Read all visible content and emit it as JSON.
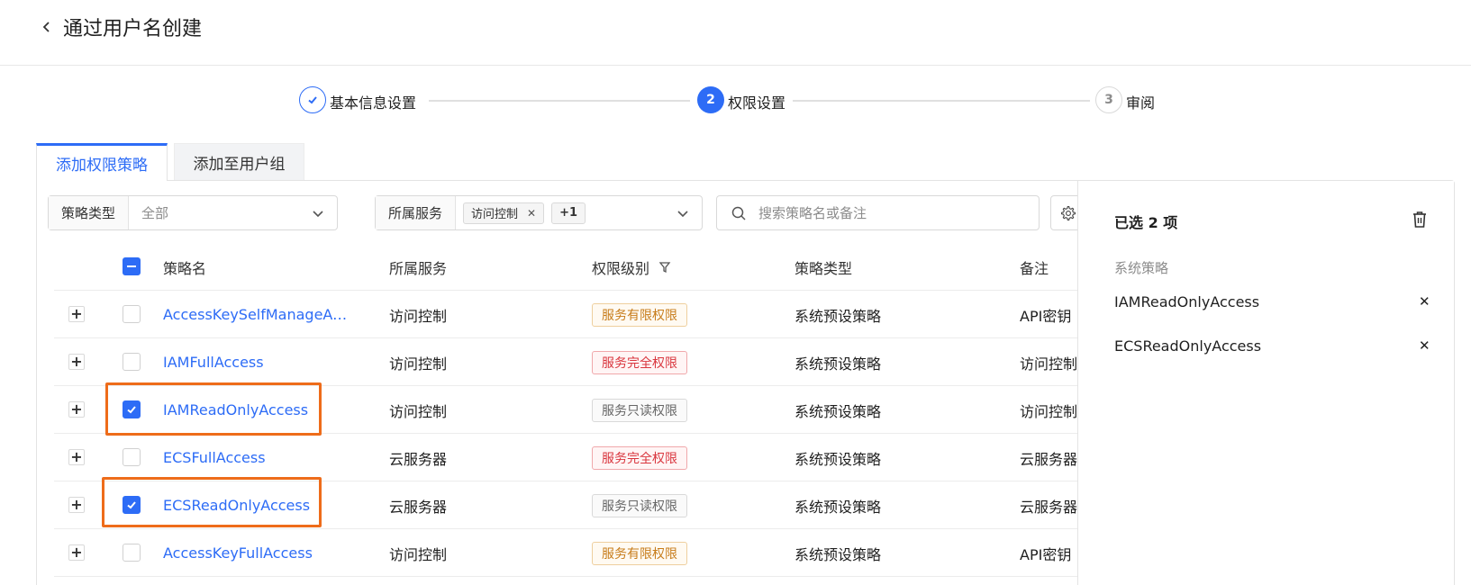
{
  "header": {
    "title": "通过用户名创建"
  },
  "steps": [
    {
      "number": "1",
      "label": "基本信息设置",
      "status": "done"
    },
    {
      "number": "2",
      "label": "权限设置",
      "status": "active"
    },
    {
      "number": "3",
      "label": "审阅",
      "status": "todo"
    }
  ],
  "tabs": [
    {
      "label": "添加权限策略",
      "active": true
    },
    {
      "label": "添加至用户组",
      "active": false
    }
  ],
  "filters": {
    "policy_type": {
      "label": "策略类型",
      "value": "全部"
    },
    "service": {
      "label": "所属服务",
      "tags": [
        "访问控制"
      ],
      "more": "+1"
    },
    "search": {
      "placeholder": "搜索策略名或备注",
      "value": ""
    }
  },
  "table": {
    "columns": [
      "策略名",
      "所属服务",
      "权限级别",
      "策略类型",
      "备注"
    ],
    "rows": [
      {
        "name": "AccessKeySelfManageAcc...",
        "service": "访问控制",
        "level": "服务有限权限",
        "level_kind": "limited",
        "type": "系统预设策略",
        "note": "API密钥",
        "checked": false
      },
      {
        "name": "IAMFullAccess",
        "service": "访问控制",
        "level": "服务完全权限",
        "level_kind": "full",
        "type": "系统预设策略",
        "note": "访问控制",
        "checked": false
      },
      {
        "name": "IAMReadOnlyAccess",
        "service": "访问控制",
        "level": "服务只读权限",
        "level_kind": "readonly",
        "type": "系统预设策略",
        "note": "访问控制",
        "checked": true
      },
      {
        "name": "ECSFullAccess",
        "service": "云服务器",
        "level": "服务完全权限",
        "level_kind": "full",
        "type": "系统预设策略",
        "note": "云服务器",
        "checked": false
      },
      {
        "name": "ECSReadOnlyAccess",
        "service": "云服务器",
        "level": "服务只读权限",
        "level_kind": "readonly",
        "type": "系统预设策略",
        "note": "云服务器",
        "checked": true
      },
      {
        "name": "AccessKeyFullAccess",
        "service": "访问控制",
        "level": "服务有限权限",
        "level_kind": "limited",
        "type": "系统预设策略",
        "note": "API密钥",
        "checked": false
      }
    ]
  },
  "selected": {
    "title": "已选 2 项",
    "section": "系统策略",
    "items": [
      "IAMReadOnlyAccess",
      "ECSReadOnlyAccess"
    ]
  },
  "colors": {
    "accent": "#2d6cf6",
    "highlight": "#ee6c1a",
    "limited": "#c77c1a",
    "full": "#d9363e"
  }
}
